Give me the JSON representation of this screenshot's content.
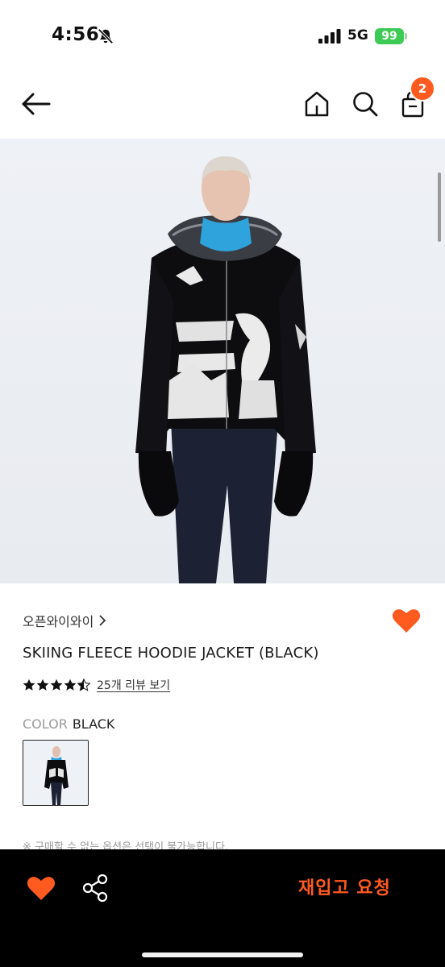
{
  "status_bar": {
    "time": "4:56",
    "network": "5G",
    "battery": "99"
  },
  "nav": {
    "cart_count": "2"
  },
  "product": {
    "brand": "오픈와이와이",
    "title": "SKIING FLEECE HOODIE JACKET (BLACK)",
    "rating": 4.5,
    "review_link": "25개 리뷰 보기",
    "color_label": "COLOR",
    "color_value": "BLACK",
    "notice": "※ 구매할 수 없는 옵션은 선택이 불가능합니다."
  },
  "action_bar": {
    "restock_label": "재입고 요청"
  },
  "colors": {
    "accent": "#ff5a1f",
    "battery": "#3ecb55"
  },
  "icons": [
    "bell-off-icon",
    "signal-icon",
    "back-arrow-icon",
    "home-icon",
    "search-icon",
    "shopping-bag-icon",
    "heart-icon",
    "star-icon",
    "share-icon"
  ]
}
